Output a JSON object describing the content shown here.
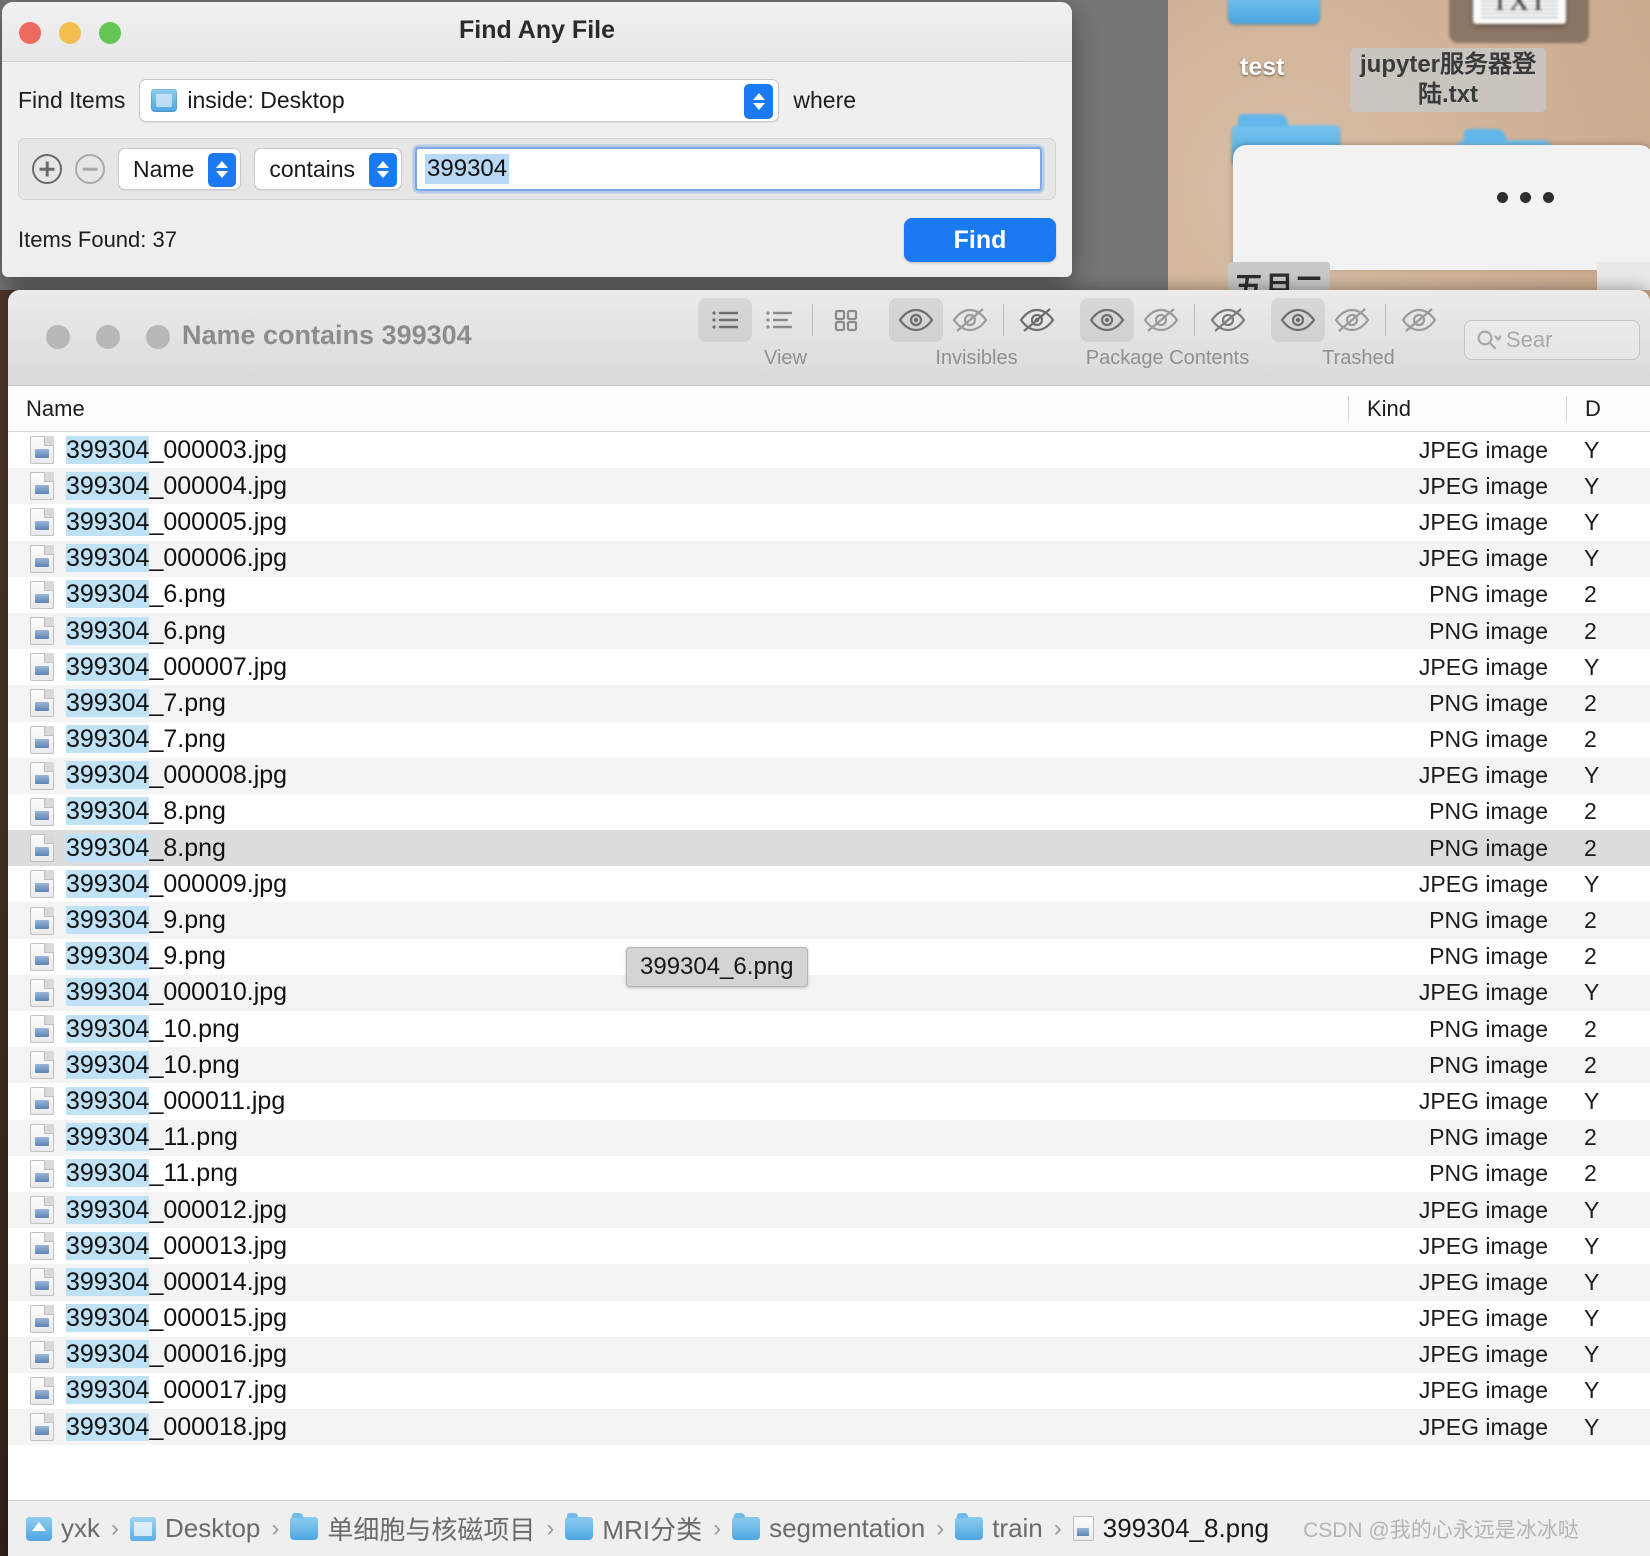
{
  "desktop": {
    "icons": [
      {
        "label": "test",
        "type": "folder-label"
      },
      {
        "label": "jupyter服务器登陆.txt",
        "type": "text-file-label"
      }
    ],
    "txt_glyph": "TXT"
  },
  "find_dialog": {
    "title": "Find Any File",
    "window_buttons": {
      "close": "close-button",
      "minimize": "minimize-button",
      "zoom": "zoom-button"
    },
    "find_items_label": "Find Items",
    "scope_value": "inside: Desktop",
    "where_label": "where",
    "add_button": "+",
    "remove_button": "−",
    "attribute_value": "Name",
    "operator_value": "contains",
    "query_value": "399304",
    "items_found": "Items Found: 37",
    "find_button": "Find"
  },
  "results_window": {
    "title": "Name contains 399304",
    "toolbar": {
      "groups": [
        {
          "label": "View",
          "buttons": [
            "list-view-icon",
            "list-detail-icon",
            "grid-view-icon"
          ]
        },
        {
          "label": "Invisibles",
          "buttons": [
            "eye-visible-icon",
            "eye-hidden-icon",
            "eye-hidden-slash-icon"
          ]
        },
        {
          "label": "Package Contents",
          "buttons": [
            "eye-visible-icon",
            "eye-hidden-icon",
            "eye-hidden-slash-icon"
          ]
        },
        {
          "label": "Trashed",
          "buttons": [
            "eye-visible-icon",
            "eye-hidden-icon",
            "eye-hidden-slash-icon"
          ]
        }
      ],
      "search_placeholder": "Sear"
    },
    "columns": [
      "Name",
      "Kind",
      "D"
    ],
    "match_term": "399304",
    "tooltip": "399304_6.png",
    "rows": [
      {
        "name": "399304_000003.jpg",
        "kind": "JPEG image",
        "date": "Y",
        "selected": false
      },
      {
        "name": "399304_000004.jpg",
        "kind": "JPEG image",
        "date": "Y",
        "selected": false
      },
      {
        "name": "399304_000005.jpg",
        "kind": "JPEG image",
        "date": "Y",
        "selected": false
      },
      {
        "name": "399304_000006.jpg",
        "kind": "JPEG image",
        "date": "Y",
        "selected": false
      },
      {
        "name": "399304_6.png",
        "kind": "PNG image",
        "date": "2",
        "selected": false
      },
      {
        "name": "399304_6.png",
        "kind": "PNG image",
        "date": "2",
        "selected": false
      },
      {
        "name": "399304_000007.jpg",
        "kind": "JPEG image",
        "date": "Y",
        "selected": false
      },
      {
        "name": "399304_7.png",
        "kind": "PNG image",
        "date": "2",
        "selected": false
      },
      {
        "name": "399304_7.png",
        "kind": "PNG image",
        "date": "2",
        "selected": false
      },
      {
        "name": "399304_000008.jpg",
        "kind": "JPEG image",
        "date": "Y",
        "selected": false
      },
      {
        "name": "399304_8.png",
        "kind": "PNG image",
        "date": "2",
        "selected": false
      },
      {
        "name": "399304_8.png",
        "kind": "PNG image",
        "date": "2",
        "selected": true
      },
      {
        "name": "399304_000009.jpg",
        "kind": "JPEG image",
        "date": "Y",
        "selected": false
      },
      {
        "name": "399304_9.png",
        "kind": "PNG image",
        "date": "2",
        "selected": false
      },
      {
        "name": "399304_9.png",
        "kind": "PNG image",
        "date": "2",
        "selected": false
      },
      {
        "name": "399304_000010.jpg",
        "kind": "JPEG image",
        "date": "Y",
        "selected": false
      },
      {
        "name": "399304_10.png",
        "kind": "PNG image",
        "date": "2",
        "selected": false
      },
      {
        "name": "399304_10.png",
        "kind": "PNG image",
        "date": "2",
        "selected": false
      },
      {
        "name": "399304_000011.jpg",
        "kind": "JPEG image",
        "date": "Y",
        "selected": false
      },
      {
        "name": "399304_11.png",
        "kind": "PNG image",
        "date": "2",
        "selected": false
      },
      {
        "name": "399304_11.png",
        "kind": "PNG image",
        "date": "2",
        "selected": false
      },
      {
        "name": "399304_000012.jpg",
        "kind": "JPEG image",
        "date": "Y",
        "selected": false
      },
      {
        "name": "399304_000013.jpg",
        "kind": "JPEG image",
        "date": "Y",
        "selected": false
      },
      {
        "name": "399304_000014.jpg",
        "kind": "JPEG image",
        "date": "Y",
        "selected": false
      },
      {
        "name": "399304_000015.jpg",
        "kind": "JPEG image",
        "date": "Y",
        "selected": false
      },
      {
        "name": "399304_000016.jpg",
        "kind": "JPEG image",
        "date": "Y",
        "selected": false
      },
      {
        "name": "399304_000017.jpg",
        "kind": "JPEG image",
        "date": "Y",
        "selected": false
      },
      {
        "name": "399304_000018.jpg",
        "kind": "JPEG image",
        "date": "Y",
        "selected": false
      }
    ],
    "breadcrumb": [
      {
        "label": "yxk",
        "icon": "home-folder-icon"
      },
      {
        "label": "Desktop",
        "icon": "desktop-folder-icon"
      },
      {
        "label": "单细胞与核磁项目",
        "icon": "folder-icon"
      },
      {
        "label": "MRI分类",
        "icon": "folder-icon"
      },
      {
        "label": "segmentation",
        "icon": "folder-icon"
      },
      {
        "label": "train",
        "icon": "folder-icon"
      },
      {
        "label": "399304_8.png",
        "icon": "file-icon"
      }
    ],
    "breadcrumb_separator": "›",
    "watermark": "CSDN @我的心永远是冰冰哒"
  },
  "colors": {
    "accent_blue": "#1b79f2",
    "match_highlight": "#bfe2f7",
    "selected_row": "#dcdcdc",
    "alt_row": "#f4f4f5"
  }
}
